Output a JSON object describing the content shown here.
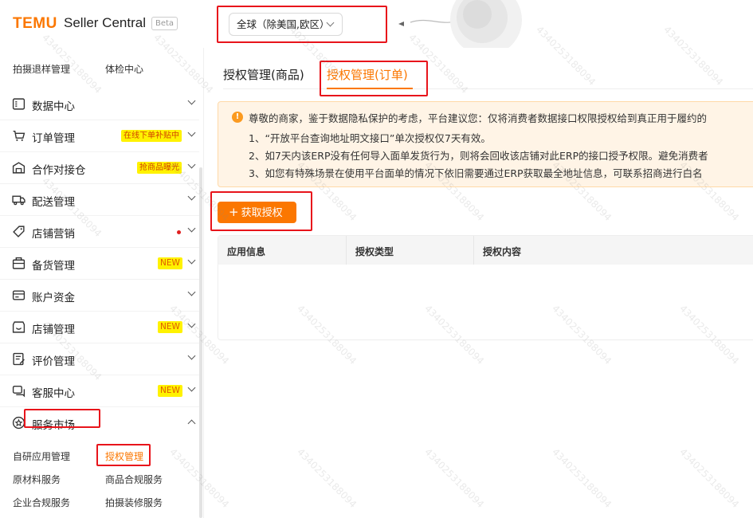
{
  "header": {
    "logo": "TEMU",
    "product": "Seller Central",
    "beta": "Beta",
    "region_select": "全球（除美国,欧区）"
  },
  "sidebar": {
    "top_sub_items": [
      "拍摄退样管理",
      "体检中心"
    ],
    "items": [
      {
        "label": "数据中心",
        "icon": "bar-chart-icon",
        "badge": ""
      },
      {
        "label": "订单管理",
        "icon": "cart-icon",
        "badge": "在线下单补贴中"
      },
      {
        "label": "合作对接仓",
        "icon": "warehouse-icon",
        "badge": "抢商品曝光"
      },
      {
        "label": "配送管理",
        "icon": "truck-icon",
        "badge": ""
      },
      {
        "label": "店铺营销",
        "icon": "tag-icon",
        "badge": ""
      },
      {
        "label": "备货管理",
        "icon": "box-icon",
        "badge": "NEW"
      },
      {
        "label": "账户资金",
        "icon": "wallet-icon",
        "badge": ""
      },
      {
        "label": "店铺管理",
        "icon": "store-icon",
        "badge": "NEW"
      },
      {
        "label": "评价管理",
        "icon": "review-icon",
        "badge": ""
      },
      {
        "label": "客服中心",
        "icon": "chat-icon",
        "badge": "NEW"
      },
      {
        "label": "服务市场",
        "icon": "service-icon",
        "badge": ""
      }
    ],
    "service_sub_items": [
      "自研应用管理",
      "授权管理",
      "原材料服务",
      "商品合规服务",
      "企业合规服务",
      "拍摄装修服务"
    ]
  },
  "main": {
    "tabs": [
      {
        "label": "授权管理(商品)"
      },
      {
        "label": "授权管理(订单)"
      }
    ],
    "notice": {
      "line1": "尊敬的商家，鉴于数据隐私保护的考虑，平台建议您：仅将消费者数据接口权限授权给到真正用于履约的",
      "line2": "1、“开放平台查询地址明文接口”单次授权仅7天有效。",
      "line3": "2、如7天内该ERP没有任何导入面单发货行为，则将会回收该店铺对此ERP的接口授予权限。避免消费者",
      "line4": "3、如您有特殊场景在使用平台面单的情况下依旧需要通过ERP获取最全地址信息，可联系招商进行白名"
    },
    "get_auth_button": "获取授权",
    "table_headers": [
      "应用信息",
      "授权类型",
      "授权内容"
    ]
  },
  "watermark": "4340253188094",
  "colors": {
    "accent": "#fb7701",
    "annotation": "#e8141b",
    "badge_bg": "#fff200"
  }
}
